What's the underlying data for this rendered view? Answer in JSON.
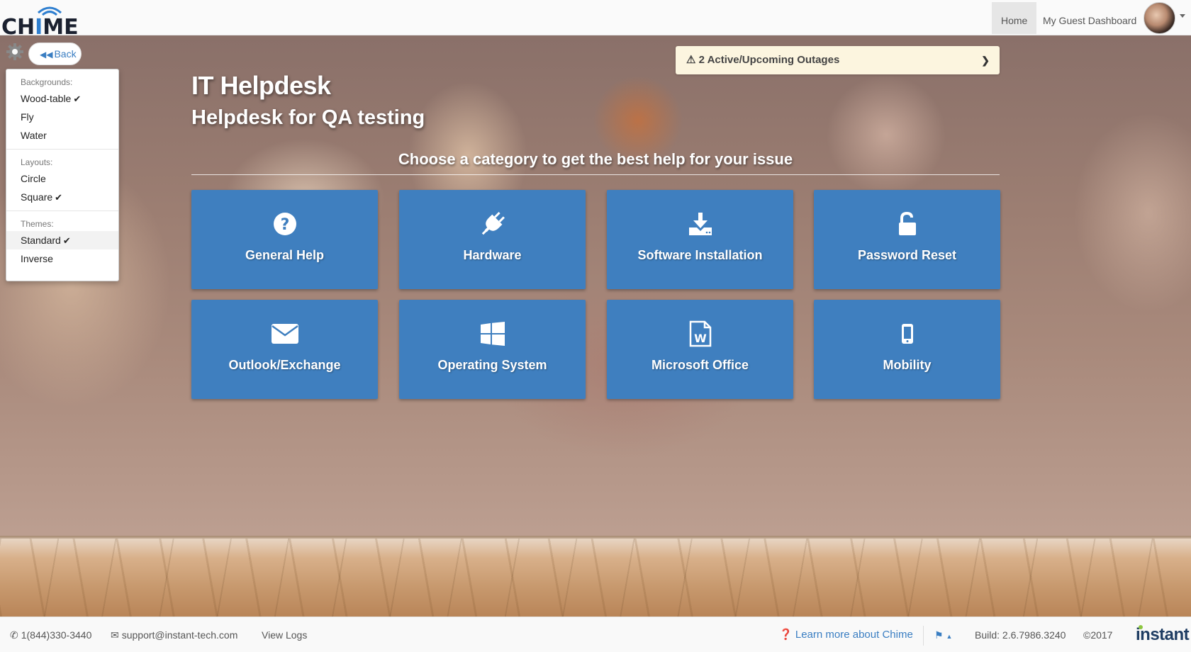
{
  "app": {
    "logo_text_pre": "CH",
    "logo_text_accent": "I",
    "logo_text_post": "ME",
    "logo_accent_color": "#2f7fd0"
  },
  "nav": {
    "home": "Home",
    "guest_dashboard": "My Guest Dashboard"
  },
  "back_label": "Back",
  "settings_menu": {
    "backgrounds_header": "Backgrounds:",
    "backgrounds": [
      {
        "label": "Wood-table",
        "checked": true
      },
      {
        "label": "Fly",
        "checked": false
      },
      {
        "label": "Water",
        "checked": false
      }
    ],
    "layouts_header": "Layouts:",
    "layouts": [
      {
        "label": "Circle",
        "checked": false
      },
      {
        "label": "Square",
        "checked": true
      }
    ],
    "themes_header": "Themes:",
    "themes": [
      {
        "label": "Standard",
        "checked": true
      },
      {
        "label": "Inverse",
        "checked": false
      }
    ]
  },
  "outage_banner": "2 Active/Upcoming Outages",
  "page": {
    "title": "IT Helpdesk",
    "subtitle": "Helpdesk for QA testing",
    "prompt": "Choose a category to get the best help for your issue"
  },
  "categories": [
    {
      "label": "General Help",
      "icon": "question-circle-icon"
    },
    {
      "label": "Hardware",
      "icon": "plug-icon"
    },
    {
      "label": "Software Installation",
      "icon": "download-icon"
    },
    {
      "label": "Password Reset",
      "icon": "unlock-icon"
    },
    {
      "label": "Outlook/Exchange",
      "icon": "envelope-icon"
    },
    {
      "label": "Operating System",
      "icon": "windows-icon"
    },
    {
      "label": "Microsoft Office",
      "icon": "word-document-icon"
    },
    {
      "label": "Mobility",
      "icon": "mobile-phone-icon"
    }
  ],
  "tile_color": "#3f7fbf",
  "footer": {
    "phone": "1(844)330-3440",
    "email": "support@instant-tech.com",
    "view_logs": "View Logs",
    "learn_more": "Learn more about Chime",
    "build": "Build: 2.6.7986.3240",
    "copyright": "©2017",
    "brand": "instant"
  }
}
